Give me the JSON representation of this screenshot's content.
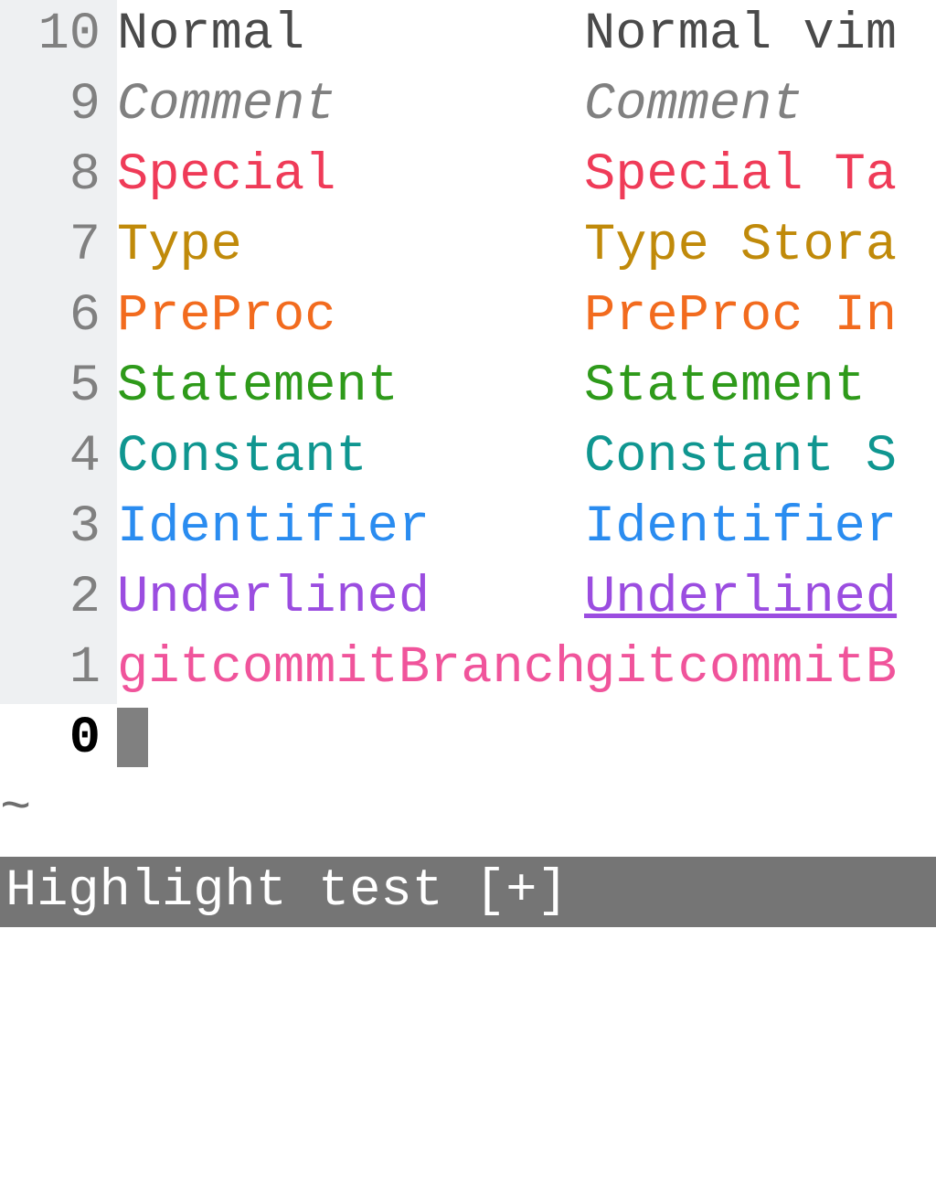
{
  "lines": [
    {
      "num": "10",
      "cls": "hl-Normal",
      "c1": "Normal",
      "c2": "Normal vim"
    },
    {
      "num": "9",
      "cls": "hl-Comment",
      "c1": "Comment",
      "c2": "Comment"
    },
    {
      "num": "8",
      "cls": "hl-Special",
      "c1": "Special",
      "c2": "Special Ta"
    },
    {
      "num": "7",
      "cls": "hl-Type",
      "c1": "Type",
      "c2": "Type Stora"
    },
    {
      "num": "6",
      "cls": "hl-PreProc",
      "c1": "PreProc",
      "c2": "PreProc In"
    },
    {
      "num": "5",
      "cls": "hl-Statement",
      "c1": "Statement",
      "c2": "Statement "
    },
    {
      "num": "4",
      "cls": "hl-Constant",
      "c1": "Constant",
      "c2": "Constant S"
    },
    {
      "num": "3",
      "cls": "hl-Identifier",
      "c1": "Identifier",
      "c2": "Identifier"
    },
    {
      "num": "2",
      "cls": "hl-Underlined",
      "c1": "Underlined",
      "c2": "Underlined"
    },
    {
      "num": "1",
      "cls": "hl-gitcommitBranch",
      "c1": "gitcommitBranch ",
      "c2": "gitcommitB"
    }
  ],
  "current_line_num": "0",
  "tilde": "~",
  "statusline": "Highlight test [+]"
}
